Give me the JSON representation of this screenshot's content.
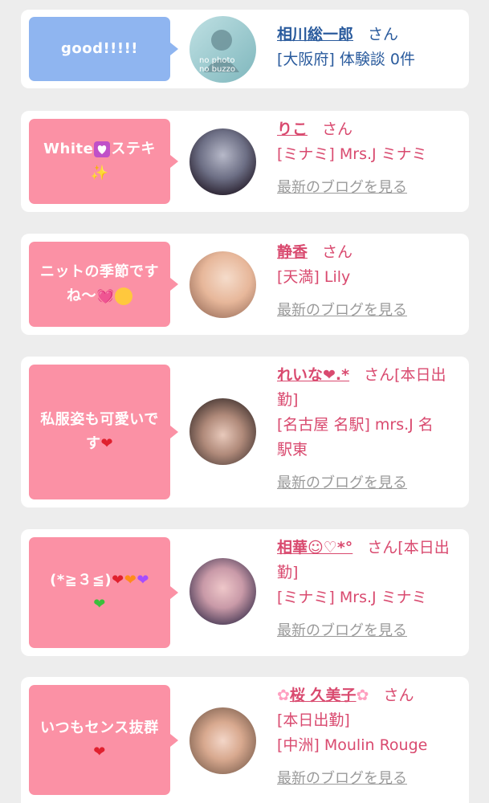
{
  "cards": [
    {
      "bubble": "good!!!!!",
      "name": "相川総一郎",
      "san": "さん",
      "shop": "[大阪府] 体験談 0件",
      "avatar_text_1": "no photo",
      "avatar_text_2": "no buzzo"
    },
    {
      "bubble_text_1": "White",
      "bubble_text_2": "ステキ",
      "name": "りこ",
      "san": "さん",
      "shop": "[ミナミ] Mrs.J ミナミ",
      "blog": "最新のブログを見る"
    },
    {
      "bubble_line1": "ニットの季節です",
      "bubble_line2": "ね〜",
      "name": "静香",
      "san": "さん",
      "shop": "[天満] Lily",
      "blog": "最新のブログを見る"
    },
    {
      "bubble_line1": "私服姿も可愛いで",
      "bubble_line2": "す",
      "name": "れいな❤︎.*",
      "san": "さん[本日出",
      "san2": "勤]",
      "shop1": "[名古屋 名駅] mrs.J 名",
      "shop2": "駅東",
      "blog": "最新のブログを見る"
    },
    {
      "bubble_line1": "(*≧３≦)",
      "name": "相華☺︎♡*°",
      "san": "さん[本日出",
      "san2": "勤]",
      "shop": "[ミナミ] Mrs.J ミナミ",
      "blog": "最新のブログを見る"
    },
    {
      "bubble_line1": "いつもセンス抜群",
      "name": "桜 久美子",
      "san": "さん",
      "status": "[本日出勤]",
      "shop": "[中洲] Moulin Rouge",
      "blog": "最新のブログを見る"
    }
  ],
  "colors": {
    "blue_bubble": "#8fb5f0",
    "pink_bubble": "#fb91a5",
    "blue_text": "#2a5b9d",
    "pink_text": "#d94a6f",
    "link_gray": "#9a9a9a",
    "background": "#ededed"
  }
}
